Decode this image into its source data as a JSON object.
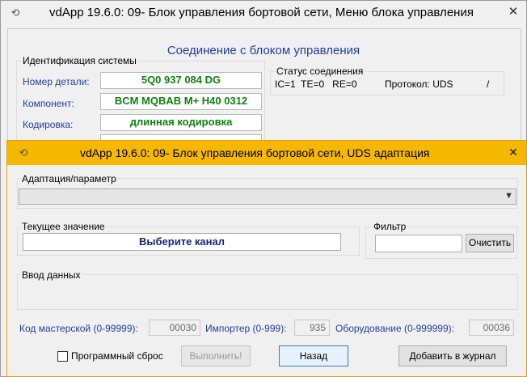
{
  "back_window": {
    "title": "vdApp 19.6.0: 09- Блок управления бортовой сети,  Меню блока управления",
    "heading": "Соединение с блоком управления",
    "identification": {
      "group_title": "Идентификация системы",
      "rows": [
        {
          "label": "Номер детали:",
          "value": "5Q0 937 084 DG"
        },
        {
          "label": "Компонент:",
          "value": "BCM MQBAB M+  H40 0312"
        },
        {
          "label": "Кодировка:",
          "value": "длинная кодировка"
        }
      ]
    },
    "connection_status": {
      "group_title": "Статус соединения",
      "line": "IC=1  TE=0   RE=0",
      "protocol": "Протокол: UDS",
      "slash": "/"
    }
  },
  "front_window": {
    "title": "vdApp 19.6.0: 09- Блок управления бортовой сети,  UDS адаптация",
    "adaptation_label": "Адаптация/параметр",
    "current_value_label": "Текущее значение",
    "current_value_text": "Выберите канал",
    "filter_label": "Фильтр",
    "filter_value": "",
    "filter_button": "Очистить",
    "data_entry_label": "Ввод данных",
    "workshop_code_label": "Код мастерской (0-99999):",
    "workshop_code_value": "00030",
    "importer_label": "Импортер (0-999):",
    "importer_value": "935",
    "equipment_label": "Оборудование (0-999999):",
    "equipment_value": "00036",
    "software_reset_label": "Программный сброс",
    "execute_button": "Выполнить!",
    "back_button": "Назад",
    "add_log_button": "Добавить в журнал"
  },
  "colors": {
    "accent_blue": "#1f3e9e",
    "value_green": "#108010",
    "active_title_bar": "#f6b700",
    "current_value_navy": "#1a237e"
  }
}
